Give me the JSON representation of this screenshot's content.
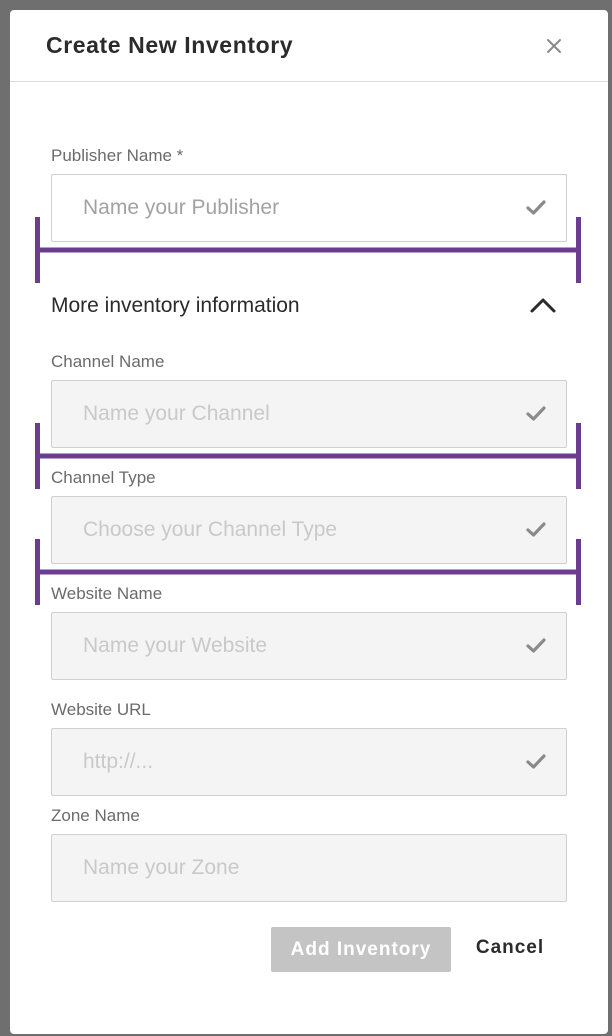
{
  "modal": {
    "title": "Create New Inventory",
    "close_icon": "close-icon"
  },
  "fields": {
    "publisher": {
      "label": "Publisher Name *",
      "placeholder": "Name your Publisher",
      "value": ""
    },
    "channel_name": {
      "label": "Channel Name",
      "placeholder": "Name your Channel",
      "value": ""
    },
    "channel_type": {
      "label": "Channel Type",
      "placeholder": "Choose your Channel Type",
      "value": ""
    },
    "website_name": {
      "label": "Website Name",
      "placeholder": "Name your Website",
      "value": ""
    },
    "website_url": {
      "label": "Website URL",
      "placeholder": "http://...",
      "value": ""
    },
    "zone_name": {
      "label": "Zone Name",
      "placeholder": "Name your Zone",
      "value": ""
    }
  },
  "section": {
    "title": "More inventory information",
    "toggle_icon": "chevron-up-icon"
  },
  "actions": {
    "add_label": "Add Inventory",
    "cancel_label": "Cancel"
  },
  "colors": {
    "annotation_bracket": "#6a3d8f",
    "check_icon": "#8a8a8a",
    "disabled_button": "#c4c4c4"
  }
}
